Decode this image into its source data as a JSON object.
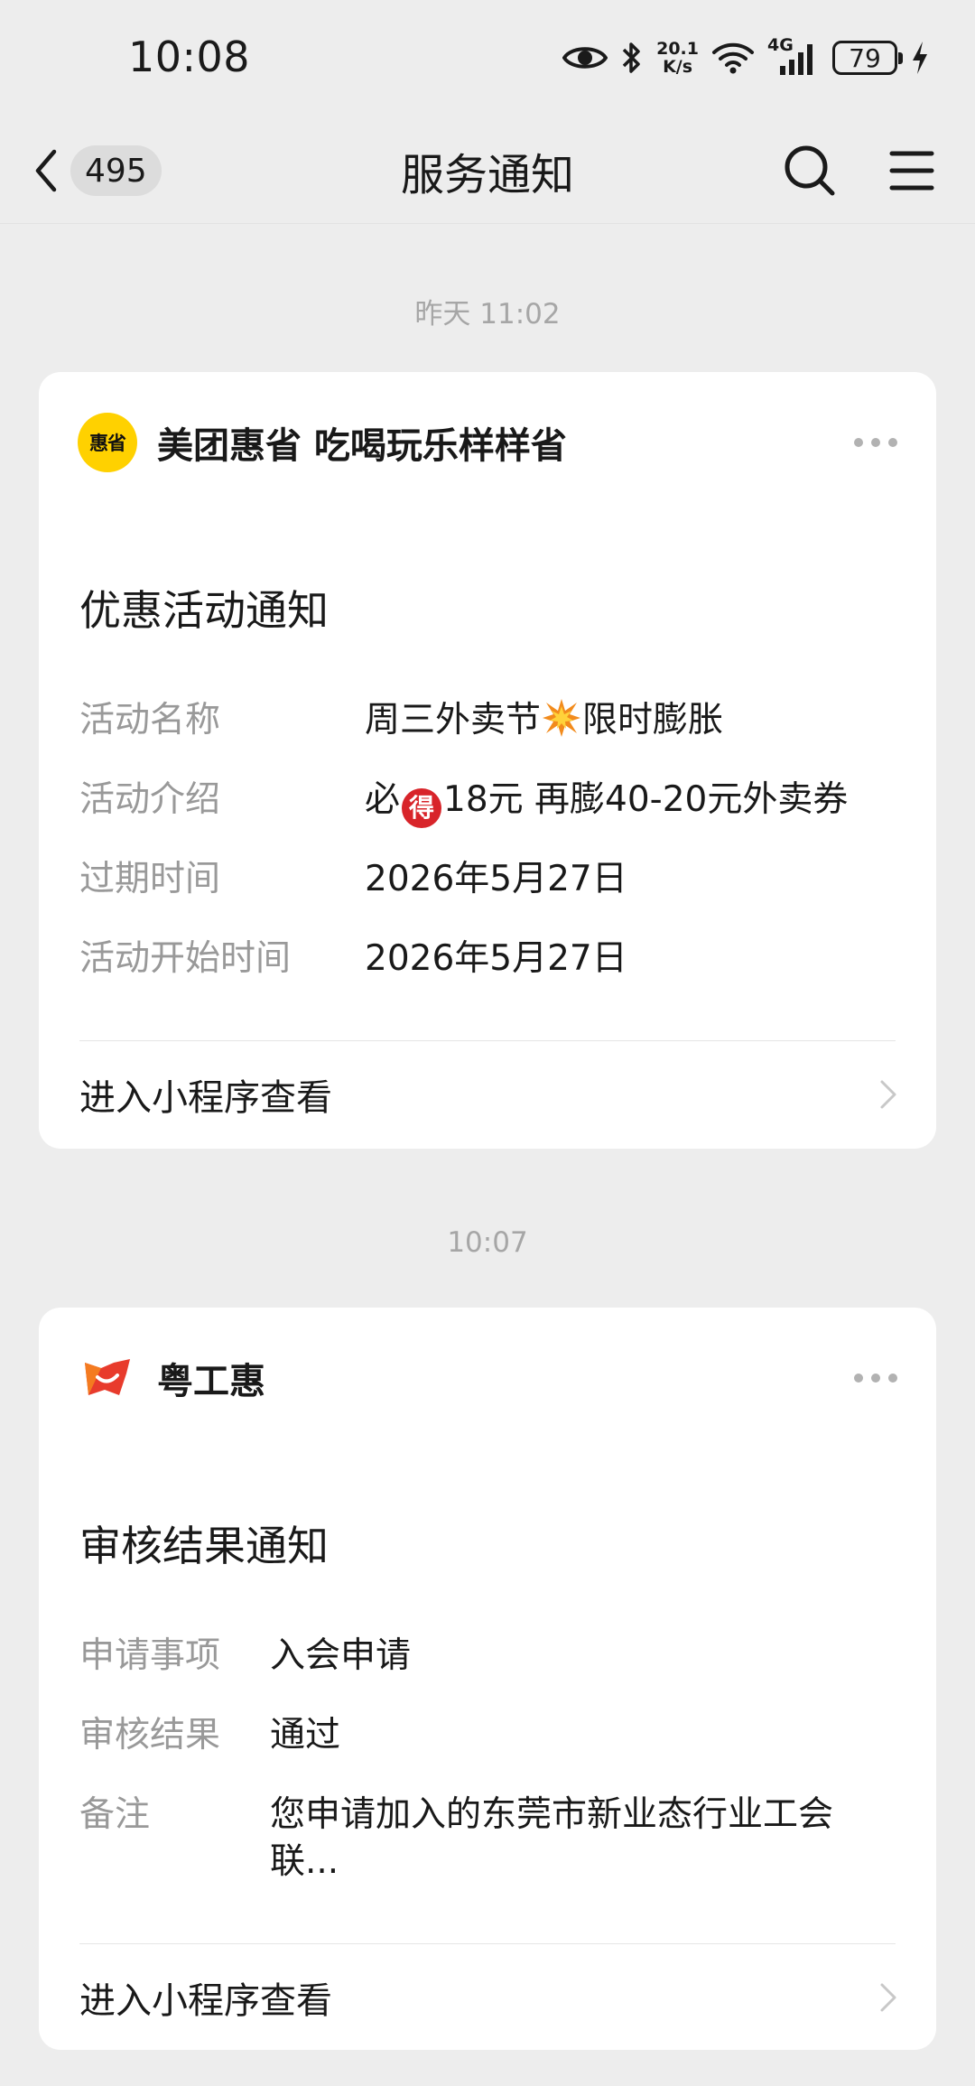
{
  "status_bar": {
    "time": "10:08",
    "speed_value": "20.1",
    "speed_unit": "K/s",
    "network": "4G",
    "battery": "79",
    "icons": [
      "eye-icon",
      "bluetooth-icon",
      "wifi-icon",
      "signal-icon",
      "battery-icon",
      "charging-icon"
    ]
  },
  "nav": {
    "unread_count": "495",
    "title": "服务通知",
    "icons": [
      "back-arrow-icon",
      "search-icon",
      "menu-icon"
    ]
  },
  "messages": [
    {
      "timestamp": "昨天 11:02",
      "brand": "美团惠省 吃喝玩乐样样省",
      "logo_text": "惠省",
      "logo_color": "#ffd100",
      "title": "优惠活动通知",
      "fields": [
        {
          "label": "活动名称",
          "value_pre": "周三外卖节",
          "value_post": "限时膨胀"
        },
        {
          "label": "活动介绍",
          "value_pre": "必",
          "value_badge": "得",
          "value_post": "18元 再膨40-20元外卖券"
        },
        {
          "label": "过期时间",
          "value": "2026年5月27日"
        },
        {
          "label": "活动开始时间",
          "value": "2026年5月27日"
        }
      ],
      "link": "进入小程序查看"
    },
    {
      "timestamp": "10:07",
      "brand": "粤工惠",
      "title": "审核结果通知",
      "fields": [
        {
          "label": "申请事项",
          "value": "入会申请"
        },
        {
          "label": "审核结果",
          "value": "通过"
        },
        {
          "label": "备注",
          "value_line1": "您申请加入的东莞市新业态行业工会",
          "value_line2": "联..."
        }
      ],
      "link": "进入小程序查看"
    }
  ]
}
